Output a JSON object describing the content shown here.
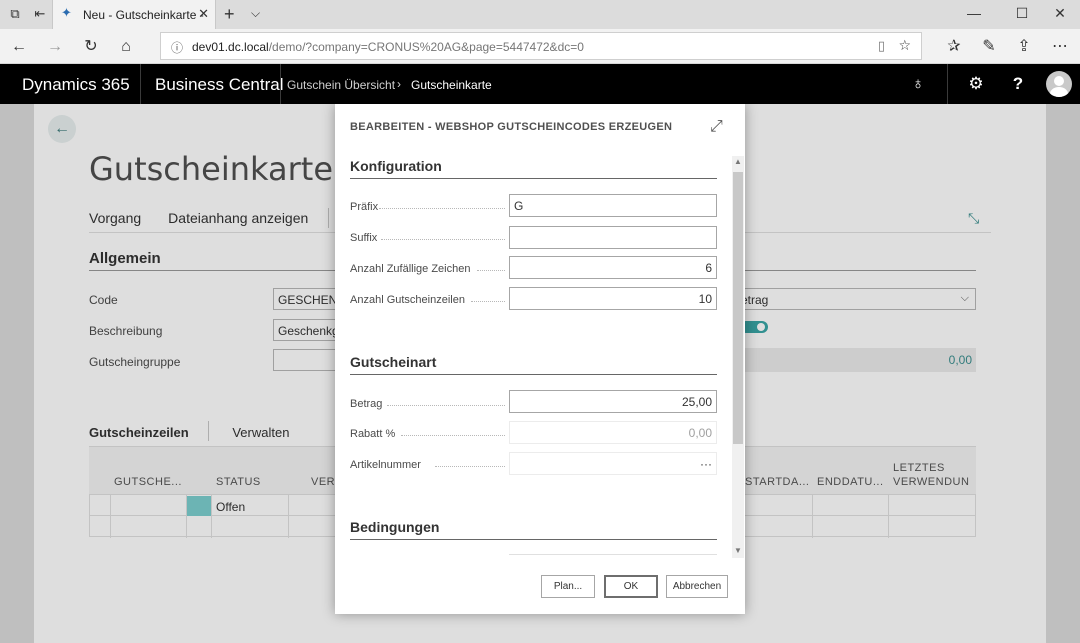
{
  "browser": {
    "tab_title": "Neu - Gutscheinkarte -",
    "url_host": "dev01.dc.local",
    "url_rest": "/demo/?company=CRONUS%20AG&page=5447472&dc=0"
  },
  "header": {
    "product": "Dynamics 365",
    "app": "Business Central",
    "breadcrumb_parent": "Gutschein Übersicht",
    "breadcrumb_current": "Gutscheinkarte"
  },
  "page": {
    "title": "Gutscheinkarte",
    "actions": [
      "Vorgang",
      "Dateianhang anzeigen"
    ],
    "section_general": "Allgemein",
    "fields": {
      "code_label": "Code",
      "code_value": "GESCHENK",
      "description_label": "Beschreibung",
      "description_value": "Geschenkgu",
      "group_label": "Gutscheingruppe",
      "right_select_value": "etrag",
      "right_amount_value": "0,00"
    },
    "lines_tab": "Gutscheinzeilen",
    "manage_tab": "Verwalten",
    "grid_headers": [
      "GUTSCHE...",
      "STATUS",
      "VERI",
      "STARTDA...",
      "ENDDATU...",
      "LETZTES",
      "VERWENDUN"
    ],
    "grid_row_status": "Offen"
  },
  "dialog": {
    "title": "BEARBEITEN - WEBSHOP GUTSCHEINCODES ERZEUGEN",
    "section_config": "Konfiguration",
    "prefix_label": "Präfix",
    "prefix_value": "G",
    "suffix_label": "Suffix",
    "suffix_value": "",
    "random_chars_label": "Anzahl Zufällige Zeichen",
    "random_chars_value": "6",
    "lines_count_label": "Anzahl Gutscheinzeilen",
    "lines_count_value": "10",
    "section_type": "Gutscheinart",
    "amount_label": "Betrag",
    "amount_value": "25,00",
    "discount_label": "Rabatt %",
    "discount_value": "0,00",
    "item_label": "Artikelnummer",
    "item_value": "···",
    "section_conditions": "Bedingungen",
    "btn_plan": "Plan...",
    "btn_ok": "OK",
    "btn_cancel": "Abbrechen"
  }
}
